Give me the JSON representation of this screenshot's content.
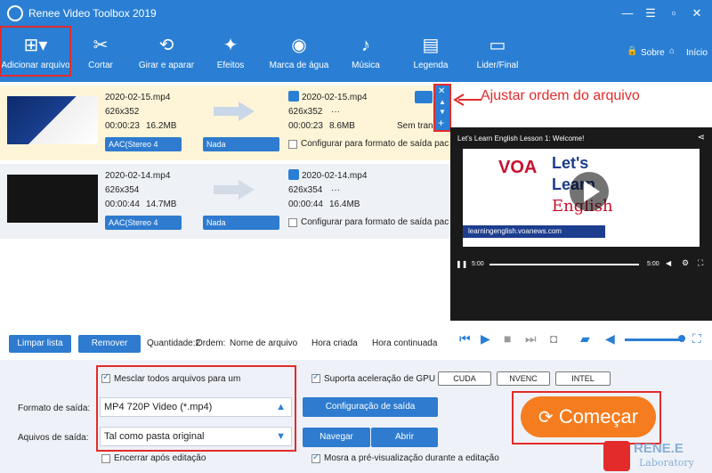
{
  "app": {
    "title": "Renee Video Toolbox 2019"
  },
  "toolbar": {
    "items": [
      {
        "label": "Adicionar arquivo"
      },
      {
        "label": "Cortar"
      },
      {
        "label": "Girar e aparar"
      },
      {
        "label": "Efeitos"
      },
      {
        "label": "Marca de água"
      },
      {
        "label": "Música"
      },
      {
        "label": "Legenda"
      },
      {
        "label": "Lider/Final"
      }
    ],
    "sobre": "Sobre",
    "inicio": "Início"
  },
  "files": [
    {
      "src_name": "2020-02-15.mp4",
      "src_res": "626x352",
      "src_dur": "00:00:23",
      "src_size": "16.2MB",
      "out_name": "2020-02-15.mp4",
      "out_res": "626x352",
      "out_extra": "···",
      "out_dur": "00:00:23",
      "out_size": "8.6MB",
      "audio": "AAC(Stereo 4",
      "subtitle": "Nada",
      "config_label": "Configurar para formato de saída pac",
      "transition": "Sem transi"
    },
    {
      "src_name": "2020-02-14.mp4",
      "src_res": "626x354",
      "src_dur": "00:00:44",
      "src_size": "14.7MB",
      "out_name": "2020-02-14.mp4",
      "out_res": "626x354",
      "out_extra": "···",
      "out_dur": "00:00:44",
      "out_size": "16.4MB",
      "audio": "AAC(Stereo 4",
      "subtitle": "Nada",
      "config_label": "Configurar para formato de saída pac"
    }
  ],
  "annotation": "Ajustar ordem do arquivo",
  "preview": {
    "video_title": "Let's Learn English Lesson 1: Welcome!",
    "brand": "VOA",
    "headline1": "Let's",
    "headline2": "Learn",
    "headline3": "English",
    "url": "learningenglish.voanews.com",
    "time_left": "5:00",
    "time_right": "5:00"
  },
  "list_actions": {
    "clear": "Limpar lista",
    "remove": "Remover",
    "quantity": "Quantidade:2",
    "order": "Ordem:",
    "sort_name": "Nome de arquivo",
    "sort_created": "Hora criada",
    "sort_continued": "Hora continuada"
  },
  "settings": {
    "merge": "Mesclar todos arquivos para um",
    "gpu": "Suporta aceleração de GPU",
    "cuda": "CUDA",
    "nvenc": "NVENC",
    "intel": "INTEL",
    "format_label": "Formato de saída:",
    "format_value": "MP4 720P Video (*.mp4)",
    "config_button": "Configuração de saída",
    "folder_label": "Aquivos de saída:",
    "folder_value": "Tal como pasta original",
    "browse": "Navegar",
    "open": "Abrir",
    "shutdown": "Encerrar após editação",
    "preview_during": "Mosra a pré-visualização durante a editação",
    "start": "Começar"
  },
  "watermark": {
    "brand": "RENE.E",
    "sub": "Laboratory"
  }
}
